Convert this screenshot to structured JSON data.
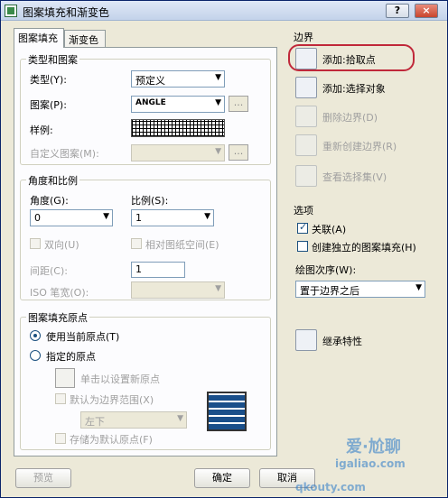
{
  "window": {
    "title": "图案填充和渐变色",
    "help": "?",
    "close": "×"
  },
  "tabs": [
    "图案填充",
    "渐变色"
  ],
  "type_pattern": {
    "heading": "类型和图案",
    "type_label": "类型(Y):",
    "type_value": "预定义",
    "pattern_label": "图案(P):",
    "pattern_value": "ANGLE",
    "swatch_label": "样例:",
    "custom_label": "自定义图案(M):",
    "browse": "..."
  },
  "angle_scale": {
    "heading": "角度和比例",
    "angle_label": "角度(G):",
    "angle_value": "0",
    "scale_label": "比例(S):",
    "scale_value": "1",
    "double_label": "双向(U)",
    "relative_label": "相对图纸空间(E)",
    "spacing_label": "间距(C):",
    "spacing_value": "1",
    "iso_label": "ISO 笔宽(O):"
  },
  "origin": {
    "heading": "图案填充原点",
    "use_current": "使用当前原点(T)",
    "specified": "指定的原点",
    "click_set": "单击以设置新原点",
    "default_extent": "默认为边界范围(X)",
    "position_value": "左下",
    "store_default": "存储为默认原点(F)"
  },
  "boundaries": {
    "heading": "边界",
    "items": [
      {
        "label": "添加:拾取点",
        "icon": "pick-point-icon",
        "enabled": true
      },
      {
        "label": "添加:选择对象",
        "icon": "select-objects-icon",
        "enabled": true
      },
      {
        "label": "删除边界(D)",
        "icon": "remove-boundary-icon",
        "enabled": false
      },
      {
        "label": "重新创建边界(R)",
        "icon": "recreate-boundary-icon",
        "enabled": false
      },
      {
        "label": "查看选择集(V)",
        "icon": "view-selection-icon",
        "enabled": false
      }
    ]
  },
  "options": {
    "heading": "选项",
    "associative": "关联(A)",
    "independent": "创建独立的图案填充(H)",
    "draw_order_label": "绘图次序(W):",
    "draw_order_value": "置于边界之后"
  },
  "inherit": "继承特性",
  "footer": {
    "preview": "预览",
    "ok": "确定",
    "cancel": "取消"
  },
  "watermark": {
    "brand": "爱·尬聊",
    "url": "igaliao.com",
    "domain": "qkouty.com"
  },
  "colors": {
    "highlight": "#c0283a",
    "titlebar": "#c3d3ea",
    "face": "#ece9d8"
  }
}
